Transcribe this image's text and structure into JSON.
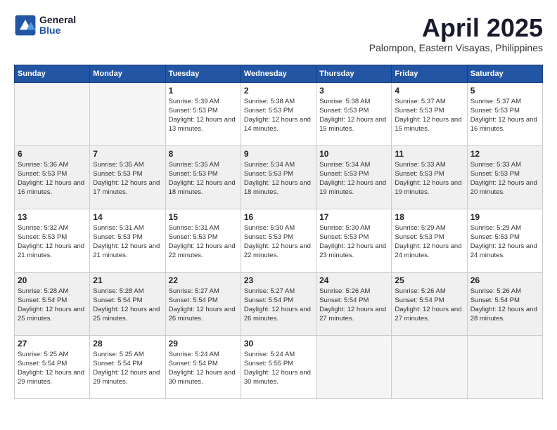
{
  "logo": {
    "line1": "General",
    "line2": "Blue"
  },
  "title": "April 2025",
  "subtitle": "Palompon, Eastern Visayas, Philippines",
  "weekdays": [
    "Sunday",
    "Monday",
    "Tuesday",
    "Wednesday",
    "Thursday",
    "Friday",
    "Saturday"
  ],
  "weeks": [
    [
      {
        "day": "",
        "empty": true
      },
      {
        "day": "",
        "empty": true
      },
      {
        "day": "1",
        "sunrise": "5:39 AM",
        "sunset": "5:53 PM",
        "daylight": "12 hours and 13 minutes."
      },
      {
        "day": "2",
        "sunrise": "5:38 AM",
        "sunset": "5:53 PM",
        "daylight": "12 hours and 14 minutes."
      },
      {
        "day": "3",
        "sunrise": "5:38 AM",
        "sunset": "5:53 PM",
        "daylight": "12 hours and 15 minutes."
      },
      {
        "day": "4",
        "sunrise": "5:37 AM",
        "sunset": "5:53 PM",
        "daylight": "12 hours and 15 minutes."
      },
      {
        "day": "5",
        "sunrise": "5:37 AM",
        "sunset": "5:53 PM",
        "daylight": "12 hours and 16 minutes."
      }
    ],
    [
      {
        "day": "6",
        "sunrise": "5:36 AM",
        "sunset": "5:53 PM",
        "daylight": "12 hours and 16 minutes."
      },
      {
        "day": "7",
        "sunrise": "5:35 AM",
        "sunset": "5:53 PM",
        "daylight": "12 hours and 17 minutes."
      },
      {
        "day": "8",
        "sunrise": "5:35 AM",
        "sunset": "5:53 PM",
        "daylight": "12 hours and 18 minutes."
      },
      {
        "day": "9",
        "sunrise": "5:34 AM",
        "sunset": "5:53 PM",
        "daylight": "12 hours and 18 minutes."
      },
      {
        "day": "10",
        "sunrise": "5:34 AM",
        "sunset": "5:53 PM",
        "daylight": "12 hours and 19 minutes."
      },
      {
        "day": "11",
        "sunrise": "5:33 AM",
        "sunset": "5:53 PM",
        "daylight": "12 hours and 19 minutes."
      },
      {
        "day": "12",
        "sunrise": "5:33 AM",
        "sunset": "5:53 PM",
        "daylight": "12 hours and 20 minutes."
      }
    ],
    [
      {
        "day": "13",
        "sunrise": "5:32 AM",
        "sunset": "5:53 PM",
        "daylight": "12 hours and 21 minutes."
      },
      {
        "day": "14",
        "sunrise": "5:31 AM",
        "sunset": "5:53 PM",
        "daylight": "12 hours and 21 minutes."
      },
      {
        "day": "15",
        "sunrise": "5:31 AM",
        "sunset": "5:53 PM",
        "daylight": "12 hours and 22 minutes."
      },
      {
        "day": "16",
        "sunrise": "5:30 AM",
        "sunset": "5:53 PM",
        "daylight": "12 hours and 22 minutes."
      },
      {
        "day": "17",
        "sunrise": "5:30 AM",
        "sunset": "5:53 PM",
        "daylight": "12 hours and 23 minutes."
      },
      {
        "day": "18",
        "sunrise": "5:29 AM",
        "sunset": "5:53 PM",
        "daylight": "12 hours and 24 minutes."
      },
      {
        "day": "19",
        "sunrise": "5:29 AM",
        "sunset": "5:53 PM",
        "daylight": "12 hours and 24 minutes."
      }
    ],
    [
      {
        "day": "20",
        "sunrise": "5:28 AM",
        "sunset": "5:54 PM",
        "daylight": "12 hours and 25 minutes."
      },
      {
        "day": "21",
        "sunrise": "5:28 AM",
        "sunset": "5:54 PM",
        "daylight": "12 hours and 25 minutes."
      },
      {
        "day": "22",
        "sunrise": "5:27 AM",
        "sunset": "5:54 PM",
        "daylight": "12 hours and 26 minutes."
      },
      {
        "day": "23",
        "sunrise": "5:27 AM",
        "sunset": "5:54 PM",
        "daylight": "12 hours and 26 minutes."
      },
      {
        "day": "24",
        "sunrise": "5:26 AM",
        "sunset": "5:54 PM",
        "daylight": "12 hours and 27 minutes."
      },
      {
        "day": "25",
        "sunrise": "5:26 AM",
        "sunset": "5:54 PM",
        "daylight": "12 hours and 27 minutes."
      },
      {
        "day": "26",
        "sunrise": "5:26 AM",
        "sunset": "5:54 PM",
        "daylight": "12 hours and 28 minutes."
      }
    ],
    [
      {
        "day": "27",
        "sunrise": "5:25 AM",
        "sunset": "5:54 PM",
        "daylight": "12 hours and 29 minutes."
      },
      {
        "day": "28",
        "sunrise": "5:25 AM",
        "sunset": "5:54 PM",
        "daylight": "12 hours and 29 minutes."
      },
      {
        "day": "29",
        "sunrise": "5:24 AM",
        "sunset": "5:54 PM",
        "daylight": "12 hours and 30 minutes."
      },
      {
        "day": "30",
        "sunrise": "5:24 AM",
        "sunset": "5:55 PM",
        "daylight": "12 hours and 30 minutes."
      },
      {
        "day": "",
        "empty": true
      },
      {
        "day": "",
        "empty": true
      },
      {
        "day": "",
        "empty": true
      }
    ]
  ]
}
